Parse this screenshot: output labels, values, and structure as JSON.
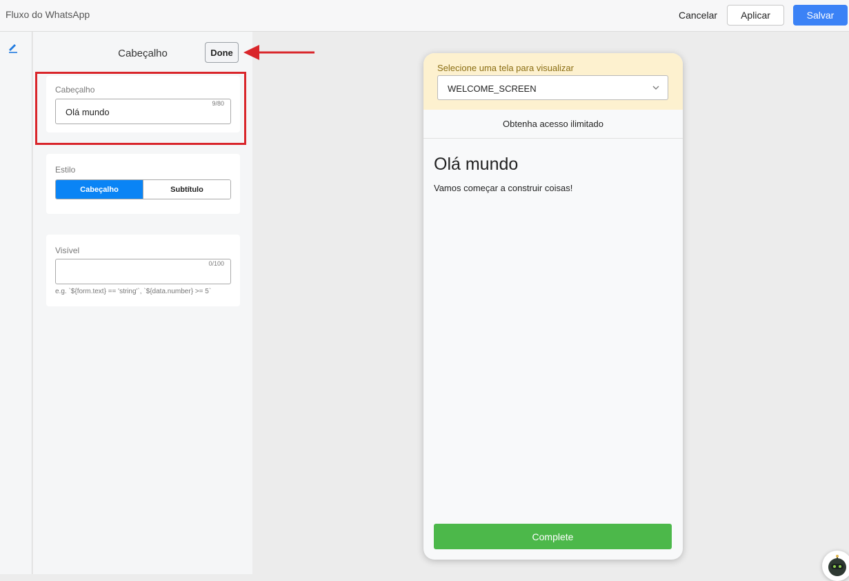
{
  "app": {
    "title": "Fluxo do WhatsApp"
  },
  "toolbar": {
    "cancel_label": "Cancelar",
    "apply_label": "Aplicar",
    "save_label": "Salvar"
  },
  "rail": {
    "icon": "pencil-icon"
  },
  "panel": {
    "title": "Cabeçalho",
    "done_label": "Done",
    "header_field": {
      "label": "Cabeçalho",
      "value": "Olá mundo",
      "counter": "9/80"
    },
    "style": {
      "label": "Estilo",
      "options": [
        "Cabeçalho",
        "Subtítulo"
      ],
      "selected": "Cabeçalho"
    },
    "visible_field": {
      "label": "Visível",
      "value": "",
      "counter": "0/100",
      "hint": "e.g. `${form.text} == 'string'`, `${data.number} >= 5`"
    }
  },
  "preview": {
    "select_label": "Selecione uma tela para visualizar",
    "selected_screen": "WELCOME_SCREEN",
    "banner": "Obtenha acesso ilimitado",
    "heading": "Olá mundo",
    "body": "Vamos começar a construir coisas!",
    "button_label": "Complete"
  },
  "colors": {
    "primary": "#3b82f6",
    "segment_active": "#0a84f5",
    "complete": "#4cb84a",
    "highlight": "#d9252a",
    "preview_header_bg": "#fdf1cf"
  }
}
